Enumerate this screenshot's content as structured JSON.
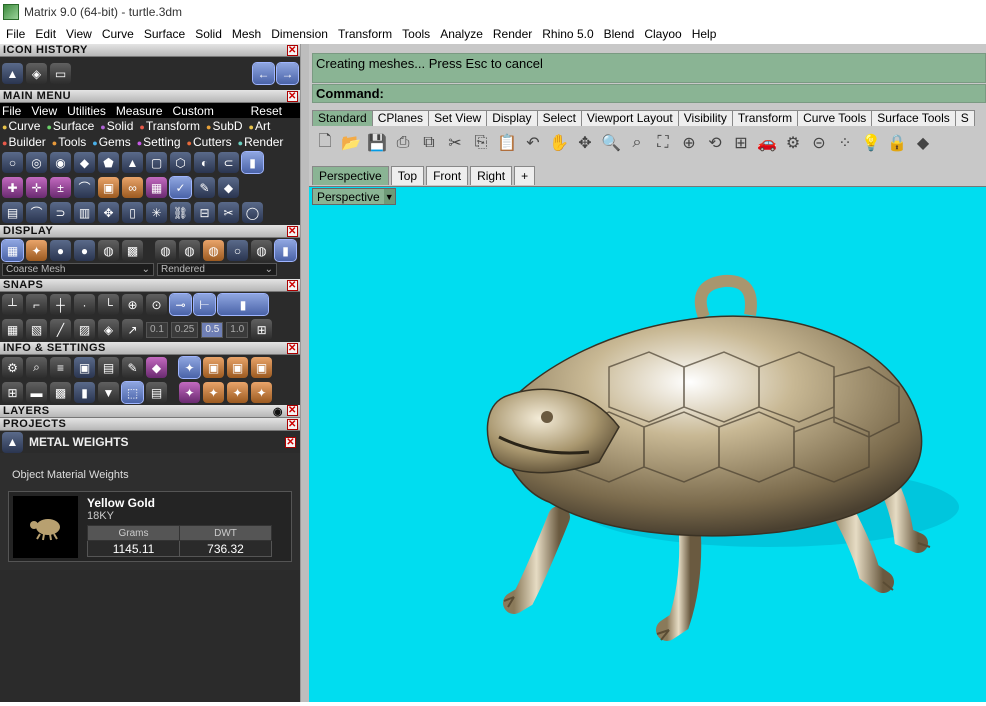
{
  "window": {
    "title": "Matrix 9.0 (64-bit) - turtle.3dm"
  },
  "menubar": [
    "File",
    "Edit",
    "View",
    "Curve",
    "Surface",
    "Solid",
    "Mesh",
    "Dimension",
    "Transform",
    "Tools",
    "Analyze",
    "Render",
    "Rhino 5.0",
    "Blend",
    "Clayoo",
    "Help"
  ],
  "panels": {
    "icon_history": "ICON HISTORY",
    "main_menu": "MAIN MENU",
    "display": "DISPLAY",
    "snaps": "SNAPS",
    "info_settings": "INFO & SETTINGS",
    "layers": "LAYERS",
    "projects": "PROJECTS",
    "metal_weights": "METAL WEIGHTS"
  },
  "main_menu": {
    "items": [
      "File",
      "View",
      "Utilities",
      "Measure",
      "Custom"
    ],
    "reset": "Reset",
    "categories": [
      {
        "label": "Curve",
        "color": "#e8c34a"
      },
      {
        "label": "Surface",
        "color": "#6ad06a"
      },
      {
        "label": "Solid",
        "color": "#b064d6"
      },
      {
        "label": "Transform",
        "color": "#e85a4a"
      },
      {
        "label": "SubD",
        "color": "#e8a23a"
      },
      {
        "label": "Art",
        "color": "#e8c34a"
      },
      {
        "label": "Builder",
        "color": "#e85a4a"
      },
      {
        "label": "Tools",
        "color": "#e89a3a"
      },
      {
        "label": "Gems",
        "color": "#4ab0e8"
      },
      {
        "label": "Setting",
        "color": "#c85ae8"
      },
      {
        "label": "Cutters",
        "color": "#e86a3a"
      },
      {
        "label": "Render",
        "color": "#6ad0c0"
      }
    ]
  },
  "display": {
    "mesh_select": "Coarse Mesh",
    "render_select": "Rendered"
  },
  "snaps": {
    "values": [
      "0.1",
      "0.25",
      "0.5",
      "1.0"
    ],
    "selected": "0.5"
  },
  "metal_weights": {
    "section_title": "Object Material Weights",
    "material": "Yellow Gold",
    "karat": "18KY",
    "col_grams": "Grams",
    "col_dwt": "DWT",
    "grams": "1145.11",
    "dwt": "736.32"
  },
  "command": {
    "status": "Creating meshes... Press Esc to cancel",
    "prompt": "Command:"
  },
  "toolbar_tabs": [
    "Standard",
    "CPlanes",
    "Set View",
    "Display",
    "Select",
    "Viewport Layout",
    "Visibility",
    "Transform",
    "Curve Tools",
    "Surface Tools",
    "S"
  ],
  "viewport_tabs": [
    "Perspective",
    "Top",
    "Front",
    "Right",
    "+"
  ],
  "viewport_label": "Perspective",
  "colors": {
    "viewport_bg": "#00ddf0",
    "command_bg": "#8ab494",
    "panel_bg": "#2b2b2b"
  }
}
